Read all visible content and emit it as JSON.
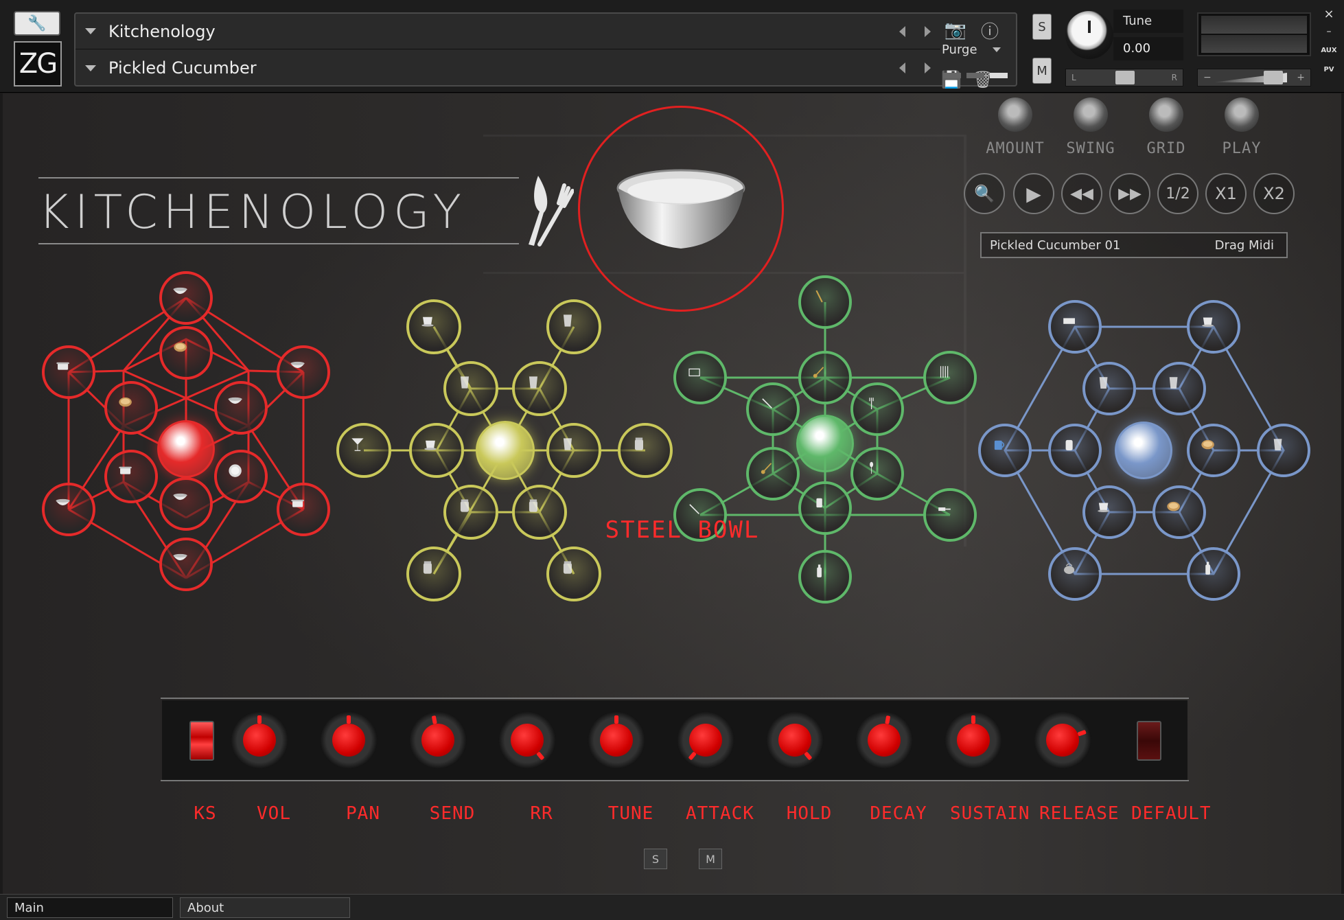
{
  "header": {
    "instrument_name": "Kitchenology",
    "preset_name": "Pickled Cucumber",
    "purge_label": "Purge",
    "solo_label": "S",
    "mute_label": "M",
    "tune_label": "Tune",
    "tune_value": "0.00",
    "pan_left": "L",
    "pan_right": "R",
    "vol_minus": "−",
    "vol_plus": "+",
    "aux_label": "AUX",
    "pv_label": "PV",
    "close_label": "×",
    "minimize_label": "–",
    "logo_text": "ZG"
  },
  "brand": {
    "title": "KITCHENOLOGY"
  },
  "controls": {
    "knobs": [
      "AMOUNT",
      "SWING",
      "GRID",
      "PLAY"
    ],
    "transport": [
      "1/2",
      "X1",
      "X2"
    ],
    "midi_pattern": "Pickled Cucumber 01",
    "drag_midi": "Drag Midi"
  },
  "sound_name": "STEEL BOWL",
  "params": [
    "KS",
    "VOL",
    "PAN",
    "SEND",
    "RR",
    "TUNE",
    "ATTACK",
    "HOLD",
    "DECAY",
    "SUSTAIN",
    "RELEASE",
    "DEFAULT"
  ],
  "bottom": {
    "solo": "S",
    "mute": "M"
  },
  "tabs": {
    "main": "Main",
    "about": "About"
  },
  "colors": {
    "red": "#e52a2a",
    "yellow": "#c9c85a",
    "green": "#5fb86a",
    "blue": "#7a97c9",
    "label_red": "#ff2b2b"
  }
}
